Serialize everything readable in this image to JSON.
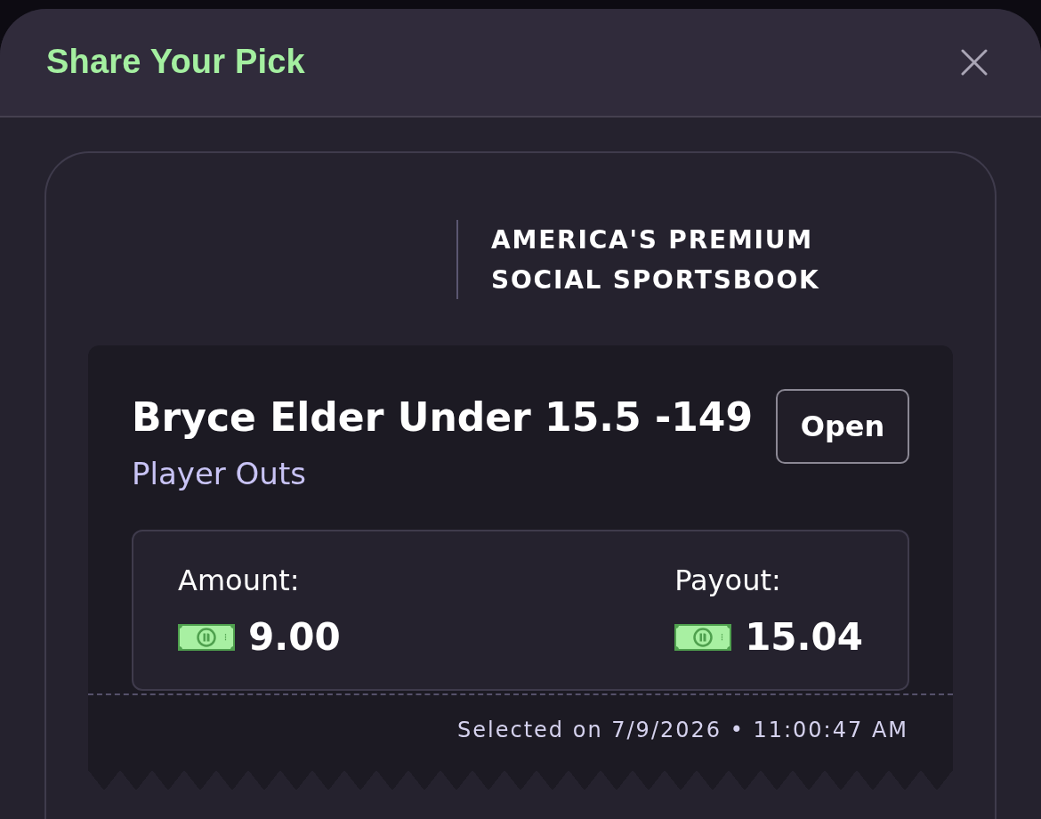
{
  "modal": {
    "title": "Share Your Pick"
  },
  "brand": {
    "tagline": "AMERICA'S PREMIUM SOCIAL SPORTSBOOK"
  },
  "ticket": {
    "pick": "Bryce Elder Under 15.5 -149",
    "market": "Player Outs",
    "status": "Open",
    "figures": [
      {
        "label": "Amount:",
        "value": "9.00"
      },
      {
        "label": "Payout:",
        "value": "15.04"
      }
    ],
    "footer": "Selected on 7/9/2026 • 11:00:47 AM"
  }
}
